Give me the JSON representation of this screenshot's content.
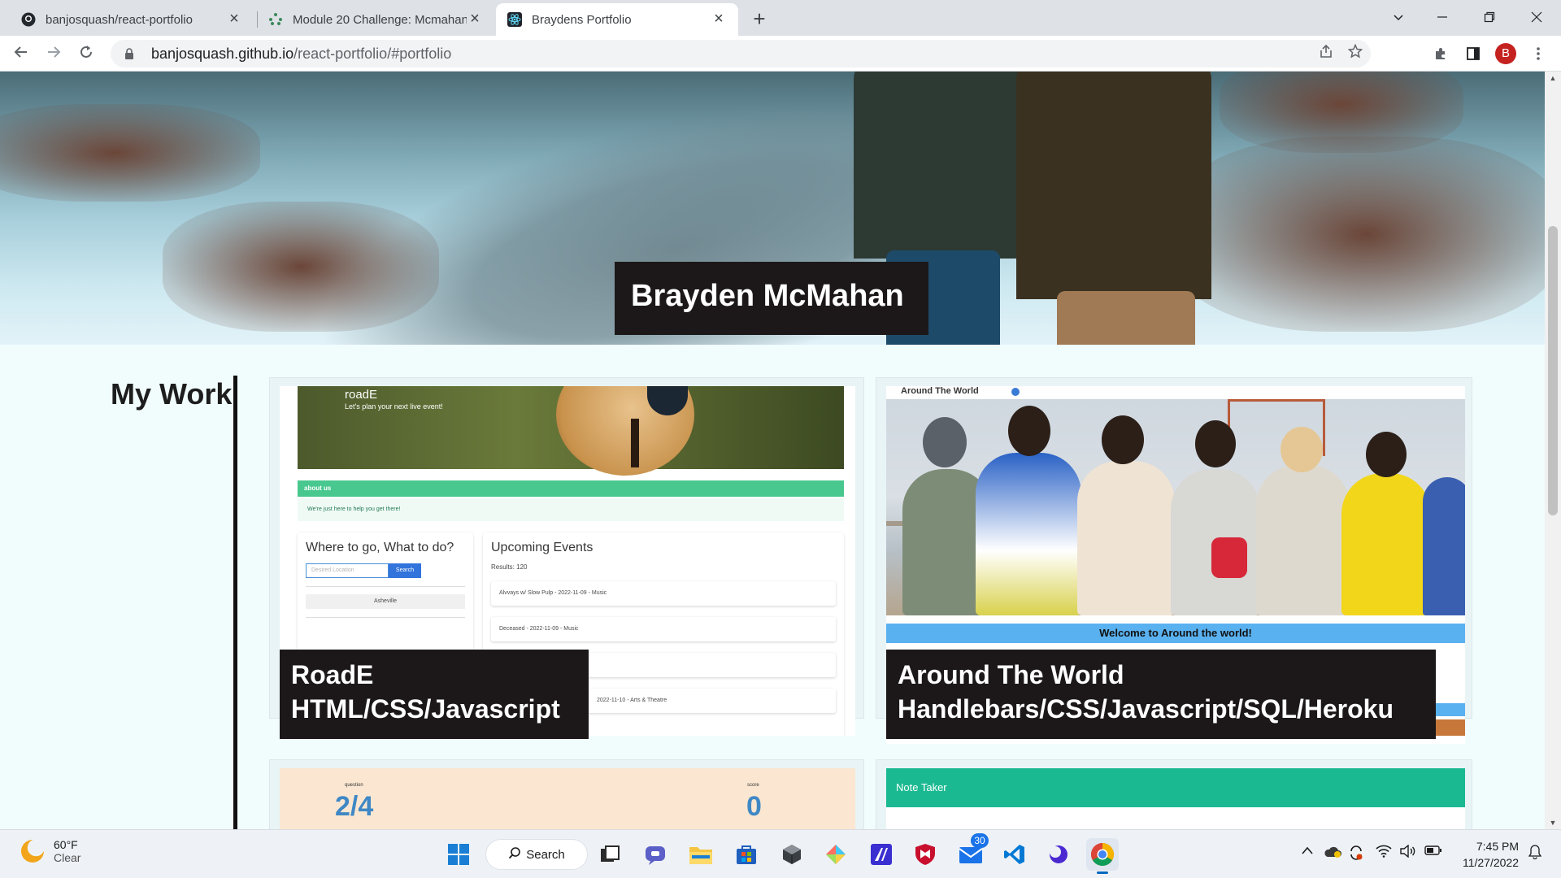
{
  "browser": {
    "tabs": [
      {
        "title": "banjosquash/react-portfolio",
        "icon": "github-icon",
        "active": false
      },
      {
        "title": "Module 20 Challenge: Mcmahan,",
        "icon": "canvas-icon",
        "active": false
      },
      {
        "title": "Braydens Portfolio",
        "icon": "react-icon",
        "active": true
      }
    ],
    "url_host": "banjosquash.github.io",
    "url_path": "/react-portfolio/#portfolio",
    "profile_initial": "B"
  },
  "page": {
    "hero_name": "Brayden McMahan",
    "section_title": "My Work",
    "projects": [
      {
        "caption_line1": "RoadE",
        "caption_line2": "HTML/CSS/Javascript",
        "thumb": {
          "app_name": "roadE",
          "tagline": "Let's plan your next live event!",
          "about_heading": "about us",
          "about_text": "We're just here to help you get there!",
          "search_heading": "Where to go, What to do?",
          "search_placeholder": "Desired Location",
          "search_button": "Search",
          "city": "Asheville",
          "events_heading": "Upcoming Events",
          "results": "Results: 120",
          "events": [
            "Alvvays w/ Slow Pulp - 2022-11-09 - Music",
            "Deceased - 2022-11-09 - Music",
            "",
            "2022-11-10 - Arts & Theatre"
          ]
        }
      },
      {
        "caption_line1": "Around The World",
        "caption_line2": "Handlebars/CSS/Javascript/SQL/Heroku",
        "thumb": {
          "site_title": "Around The World",
          "welcome": "Welcome to Around the world!"
        }
      },
      {
        "thumb": {
          "question_label": "question",
          "question_value": "2/4",
          "score_label": "score",
          "score_value": "0"
        }
      },
      {
        "thumb": {
          "header": "Note Taker"
        }
      }
    ]
  },
  "taskbar": {
    "temperature": "60°F",
    "condition": "Clear",
    "search_label": "Search",
    "mail_badge": "30",
    "time": "7:45 PM",
    "date": "11/27/2022"
  },
  "colors": {
    "page_bg": "#f1fcfd",
    "caption_bg": "#1c1819",
    "roade_green": "#48c78e",
    "welcome_blue": "#5ab1f0",
    "notetaker_teal": "#1bb991",
    "quiz_bg": "#fbe7d1"
  }
}
